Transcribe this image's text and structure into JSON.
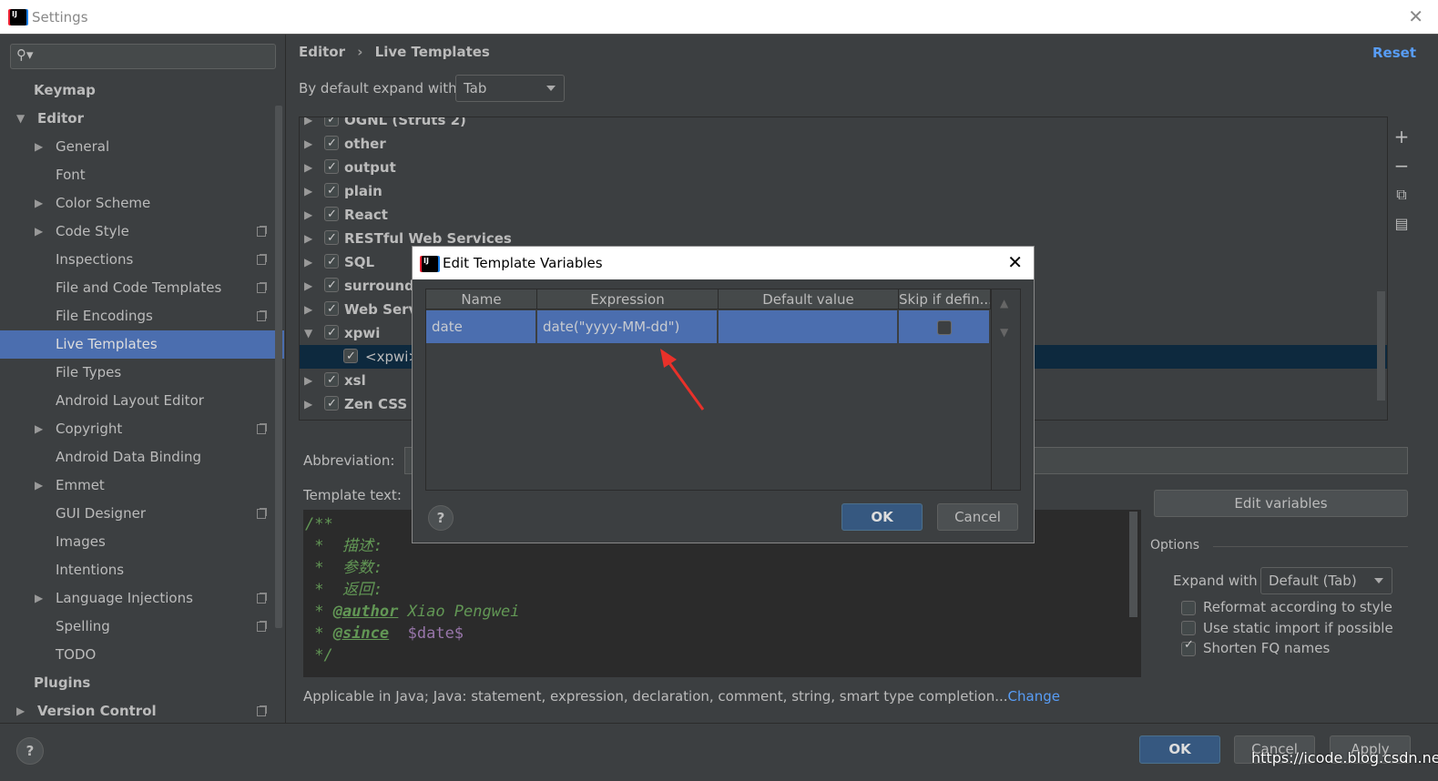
{
  "window": {
    "title": "Settings"
  },
  "sidebar": {
    "items": [
      {
        "label": "Keymap",
        "indent": 0,
        "bold": true
      },
      {
        "label": "Editor",
        "indent": 0,
        "bold": true,
        "arrow": "down"
      },
      {
        "label": "General",
        "indent": 1,
        "arrow": "right"
      },
      {
        "label": "Font",
        "indent": 1
      },
      {
        "label": "Color Scheme",
        "indent": 1,
        "arrow": "right"
      },
      {
        "label": "Code Style",
        "indent": 1,
        "arrow": "right",
        "copy": true
      },
      {
        "label": "Inspections",
        "indent": 1,
        "copy": true
      },
      {
        "label": "File and Code Templates",
        "indent": 1,
        "copy": true
      },
      {
        "label": "File Encodings",
        "indent": 1,
        "copy": true
      },
      {
        "label": "Live Templates",
        "indent": 1,
        "selected": true
      },
      {
        "label": "File Types",
        "indent": 1
      },
      {
        "label": "Android Layout Editor",
        "indent": 1
      },
      {
        "label": "Copyright",
        "indent": 1,
        "arrow": "right",
        "copy": true
      },
      {
        "label": "Android Data Binding",
        "indent": 1
      },
      {
        "label": "Emmet",
        "indent": 1,
        "arrow": "right"
      },
      {
        "label": "GUI Designer",
        "indent": 1,
        "copy": true
      },
      {
        "label": "Images",
        "indent": 1
      },
      {
        "label": "Intentions",
        "indent": 1
      },
      {
        "label": "Language Injections",
        "indent": 1,
        "arrow": "right",
        "copy": true
      },
      {
        "label": "Spelling",
        "indent": 1,
        "copy": true
      },
      {
        "label": "TODO",
        "indent": 1
      },
      {
        "label": "Plugins",
        "indent": 0,
        "bold": true
      },
      {
        "label": "Version Control",
        "indent": 0,
        "bold": true,
        "arrow": "right",
        "copy": true
      }
    ]
  },
  "header": {
    "breadcrumb": [
      "Editor",
      "Live Templates"
    ],
    "reset": "Reset",
    "expand_label": "By default expand with",
    "expand_value": "Tab"
  },
  "tree": {
    "items": [
      {
        "label": "OGNL (Struts 2)",
        "checked": true
      },
      {
        "label": "other",
        "checked": true
      },
      {
        "label": "output",
        "checked": true
      },
      {
        "label": "plain",
        "checked": true
      },
      {
        "label": "React",
        "checked": true
      },
      {
        "label": "RESTful Web Services",
        "checked": true
      },
      {
        "label": "SQL",
        "checked": true
      },
      {
        "label": "surround",
        "checked": true
      },
      {
        "label": "Web Services",
        "checked": true
      },
      {
        "label": "xpwi",
        "checked": true,
        "expanded": true
      },
      {
        "label": "<xpwi>",
        "checked": true,
        "child": true,
        "selected": true
      },
      {
        "label": "xsl",
        "checked": true
      },
      {
        "label": "Zen CSS",
        "checked": true
      }
    ]
  },
  "editor": {
    "abbreviation_label": "Abbreviation:",
    "template_text_label": "Template text:",
    "code_lines": [
      "/**",
      " *  描述:",
      " *  参数:",
      " *  返回:"
    ],
    "author_tag": "@author",
    "author_value": " Xiao Pengwei",
    "since_tag": "@since",
    "since_value": "$date$",
    "end": " */",
    "applicable": "Applicable in Java; Java: statement, expression, declaration, comment, string, smart type completion...",
    "change_link": "Change",
    "edit_variables": "Edit variables"
  },
  "options": {
    "title": "Options",
    "expand_with_label": "Expand with",
    "expand_with_value": "Default (Tab)",
    "checkboxes": [
      {
        "label": "Reformat according to style",
        "checked": false
      },
      {
        "label": "Use static import if possible",
        "checked": false
      },
      {
        "label": "Shorten FQ names",
        "checked": true
      }
    ]
  },
  "footer": {
    "ok": "OK",
    "cancel": "Cancel",
    "apply": "Apply",
    "watermark": "https://icode.blog.csdn.net"
  },
  "dialog": {
    "title": "Edit Template Variables",
    "columns": [
      "Name",
      "Expression",
      "Default value",
      "Skip if defin..."
    ],
    "rows": [
      {
        "name": "date",
        "expression": "date(\"yyyy-MM-dd\")",
        "default_value": "",
        "skip": false
      }
    ],
    "ok": "OK",
    "cancel": "Cancel"
  },
  "colors": {
    "accent": "#4b6eaf",
    "primary_button": "#365880",
    "link": "#589df6",
    "arrow_annotation": "#e8312a"
  }
}
